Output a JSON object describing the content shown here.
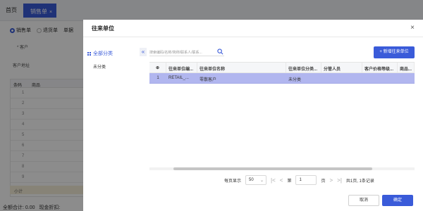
{
  "app": {
    "tabs": {
      "home": "首页",
      "active": "销售单",
      "active_close": "×"
    },
    "radios": [
      {
        "label": "销售单",
        "checked": true
      },
      {
        "label": "退货单",
        "checked": false
      }
    ],
    "field_labels": {
      "customer": "* 客户",
      "address": "客户地址",
      "type_label": "单据"
    },
    "grid": {
      "headers": [
        "条码",
        "商品"
      ],
      "row_numbers": [
        "1",
        "2",
        "3",
        "4",
        "5",
        "6",
        "7",
        "8",
        "9"
      ],
      "subtotal": "小计"
    },
    "footer": {
      "total_label": "全额合计: 0.00",
      "discount_label": "现金折扣:"
    }
  },
  "modal": {
    "title": "往来单位",
    "close": "×",
    "categories": {
      "all": "全部分类",
      "none": "未分类"
    },
    "collapse": "«",
    "search_placeholder": "搜索编码/名称/简称/联系人/联系...",
    "add_button": "+ 新增往来单位",
    "columns": [
      "⊕",
      "往来单位编...",
      "往来单位名称",
      "往来单位分类...",
      "分管人员",
      "客户价格等级...",
      "商品..."
    ],
    "rows": [
      {
        "index": "1",
        "code": "RETAIL_...",
        "name": "零散客户",
        "category": "未分类",
        "staff": "",
        "price_level": "",
        "goods": ""
      }
    ],
    "pager": {
      "per_page_label": "每页显示",
      "per_page_value": "50",
      "page_prefix": "第",
      "page_value": "1",
      "page_suffix": "页",
      "summary": "共1页, 1条记录"
    },
    "footer": {
      "cancel": "取消",
      "ok": "确定"
    }
  },
  "colors": {
    "accent": "#3a5bd9",
    "selected_row": "#b1b6ef",
    "overlay": "rgba(0,0,0,0.45)"
  }
}
